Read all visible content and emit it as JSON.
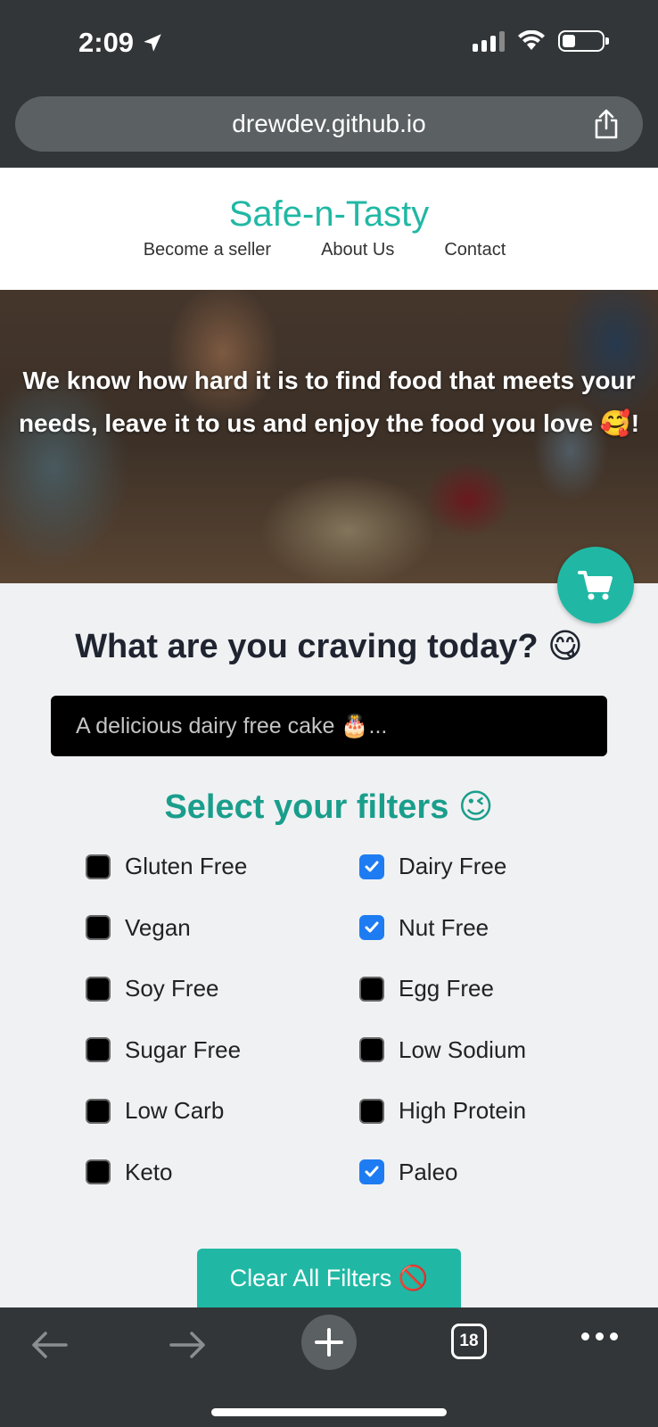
{
  "status_bar": {
    "time": "2:09"
  },
  "browser": {
    "url": "drewdev.github.io",
    "tab_count": "18"
  },
  "site": {
    "brand": "Safe-n-Tasty",
    "nav": [
      "Become a seller",
      "About Us",
      "Contact"
    ]
  },
  "hero": {
    "text": "We know how hard it is to find food that meets your needs, leave it to us and enjoy the food you love 🥰!"
  },
  "main": {
    "craving_title": "What are you craving today? 😋",
    "search_placeholder": "A delicious dairy free cake 🎂...",
    "filters_title": "Select your filters 😉",
    "filters": [
      {
        "label": "Gluten Free",
        "checked": false
      },
      {
        "label": "Dairy Free",
        "checked": true
      },
      {
        "label": "Vegan",
        "checked": false
      },
      {
        "label": "Nut Free",
        "checked": true
      },
      {
        "label": "Soy Free",
        "checked": false
      },
      {
        "label": "Egg Free",
        "checked": false
      },
      {
        "label": "Sugar Free",
        "checked": false
      },
      {
        "label": "Low Sodium",
        "checked": false
      },
      {
        "label": "Low Carb",
        "checked": false
      },
      {
        "label": "High Protein",
        "checked": false
      },
      {
        "label": "Keto",
        "checked": false
      },
      {
        "label": "Paleo",
        "checked": true
      }
    ],
    "clear_button": "Clear All Filters 🚫"
  },
  "icons": {
    "cart": "shopping-cart-icon",
    "share": "share-icon",
    "back": "arrow-left-icon",
    "forward": "arrow-right-icon",
    "new_tab": "plus-icon",
    "more": "ellipsis-icon"
  },
  "colors": {
    "accent": "#20b8a4",
    "filter_title": "#1a9e8c",
    "checkbox_checked": "#1e7cf2",
    "chrome": "#323638"
  }
}
